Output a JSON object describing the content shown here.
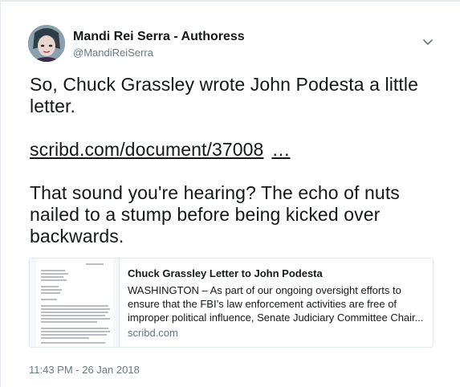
{
  "author": {
    "display_name": "Mandi Rei Serra - Authoress",
    "handle": "@MandiReiSerra"
  },
  "tweet": {
    "line1": "So, Chuck Grassley wrote John Podesta a little letter.",
    "link_text": "scribd.com/document/37008",
    "link_ellipsis": "…",
    "line2": "That sound you're hearing? The echo of nuts nailed to a stump before being kicked over backwards.",
    "timestamp": "11:43 PM - 26 Jan 2018"
  },
  "card": {
    "title": "Chuck Grassley Letter to John Podesta",
    "description": "WASHINGTON – As part of our ongoing oversight efforts to ensure that the FBI’s law enforcement activities are free of improper political influence, Senate Judiciary Committee Chair...",
    "domain": "scribd.com"
  },
  "icons": {
    "caret": "chevron-down-icon"
  },
  "colors": {
    "text": "#14171a",
    "muted": "#657786",
    "border": "#e1e8ed"
  }
}
